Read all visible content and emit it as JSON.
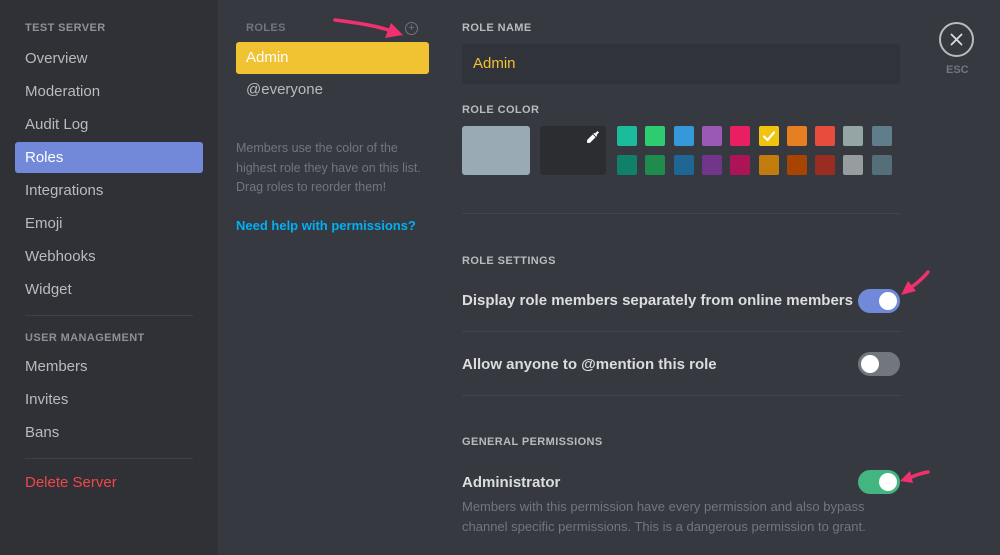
{
  "sidebar": {
    "server_header": "TEST SERVER",
    "items": [
      "Overview",
      "Moderation",
      "Audit Log",
      "Roles",
      "Integrations",
      "Emoji",
      "Webhooks",
      "Widget"
    ],
    "active_item": "Roles",
    "user_mgmt_header": "USER MANAGEMENT",
    "user_items": [
      "Members",
      "Invites",
      "Bans"
    ],
    "delete_label": "Delete Server"
  },
  "roles": {
    "header": "ROLES",
    "add_icon": "plus-circle-icon",
    "items": [
      "Admin",
      "@everyone"
    ],
    "selected": "Admin",
    "help_text": "Members use the color of the highest role they have on this list. Drag roles to reorder them!",
    "permissions_link": "Need help with permissions?"
  },
  "role_name": {
    "title": "ROLE NAME",
    "value": "Admin"
  },
  "role_color": {
    "title": "ROLE COLOR",
    "default_color": "#99aab5",
    "selected": "#f1c40f",
    "swatches_top": [
      "#1abc9c",
      "#2ecc71",
      "#3498db",
      "#9b59b6",
      "#e91e63",
      "#f1c40f",
      "#e67e22",
      "#e74c3c",
      "#95a5a6",
      "#607d8b"
    ],
    "swatches_bottom": [
      "#11806a",
      "#1f8b4c",
      "#206694",
      "#71368a",
      "#ad1457",
      "#c27c0e",
      "#a84300",
      "#992d22",
      "#979c9f",
      "#546e7a"
    ]
  },
  "role_settings": {
    "title": "ROLE SETTINGS",
    "hoist_label": "Display role members separately from online members",
    "hoist_on": true,
    "mention_label": "Allow anyone to @mention this role",
    "mention_on": false
  },
  "general_permissions": {
    "title": "GENERAL PERMISSIONS",
    "admin_label": "Administrator",
    "admin_on": true,
    "admin_desc": "Members with this permission have every permission and also bypass channel specific permissions. This is a dangerous permission to grant."
  },
  "close": {
    "label": "ESC",
    "icon": "close-icon"
  },
  "colors": {
    "accent": "#7289da",
    "toggle_on_blue": "#7289da",
    "toggle_on_green": "#43b581",
    "toggle_off": "#72767d",
    "danger": "#f04747",
    "link": "#00b0f4",
    "annotation_arrow": "#f0306f"
  }
}
